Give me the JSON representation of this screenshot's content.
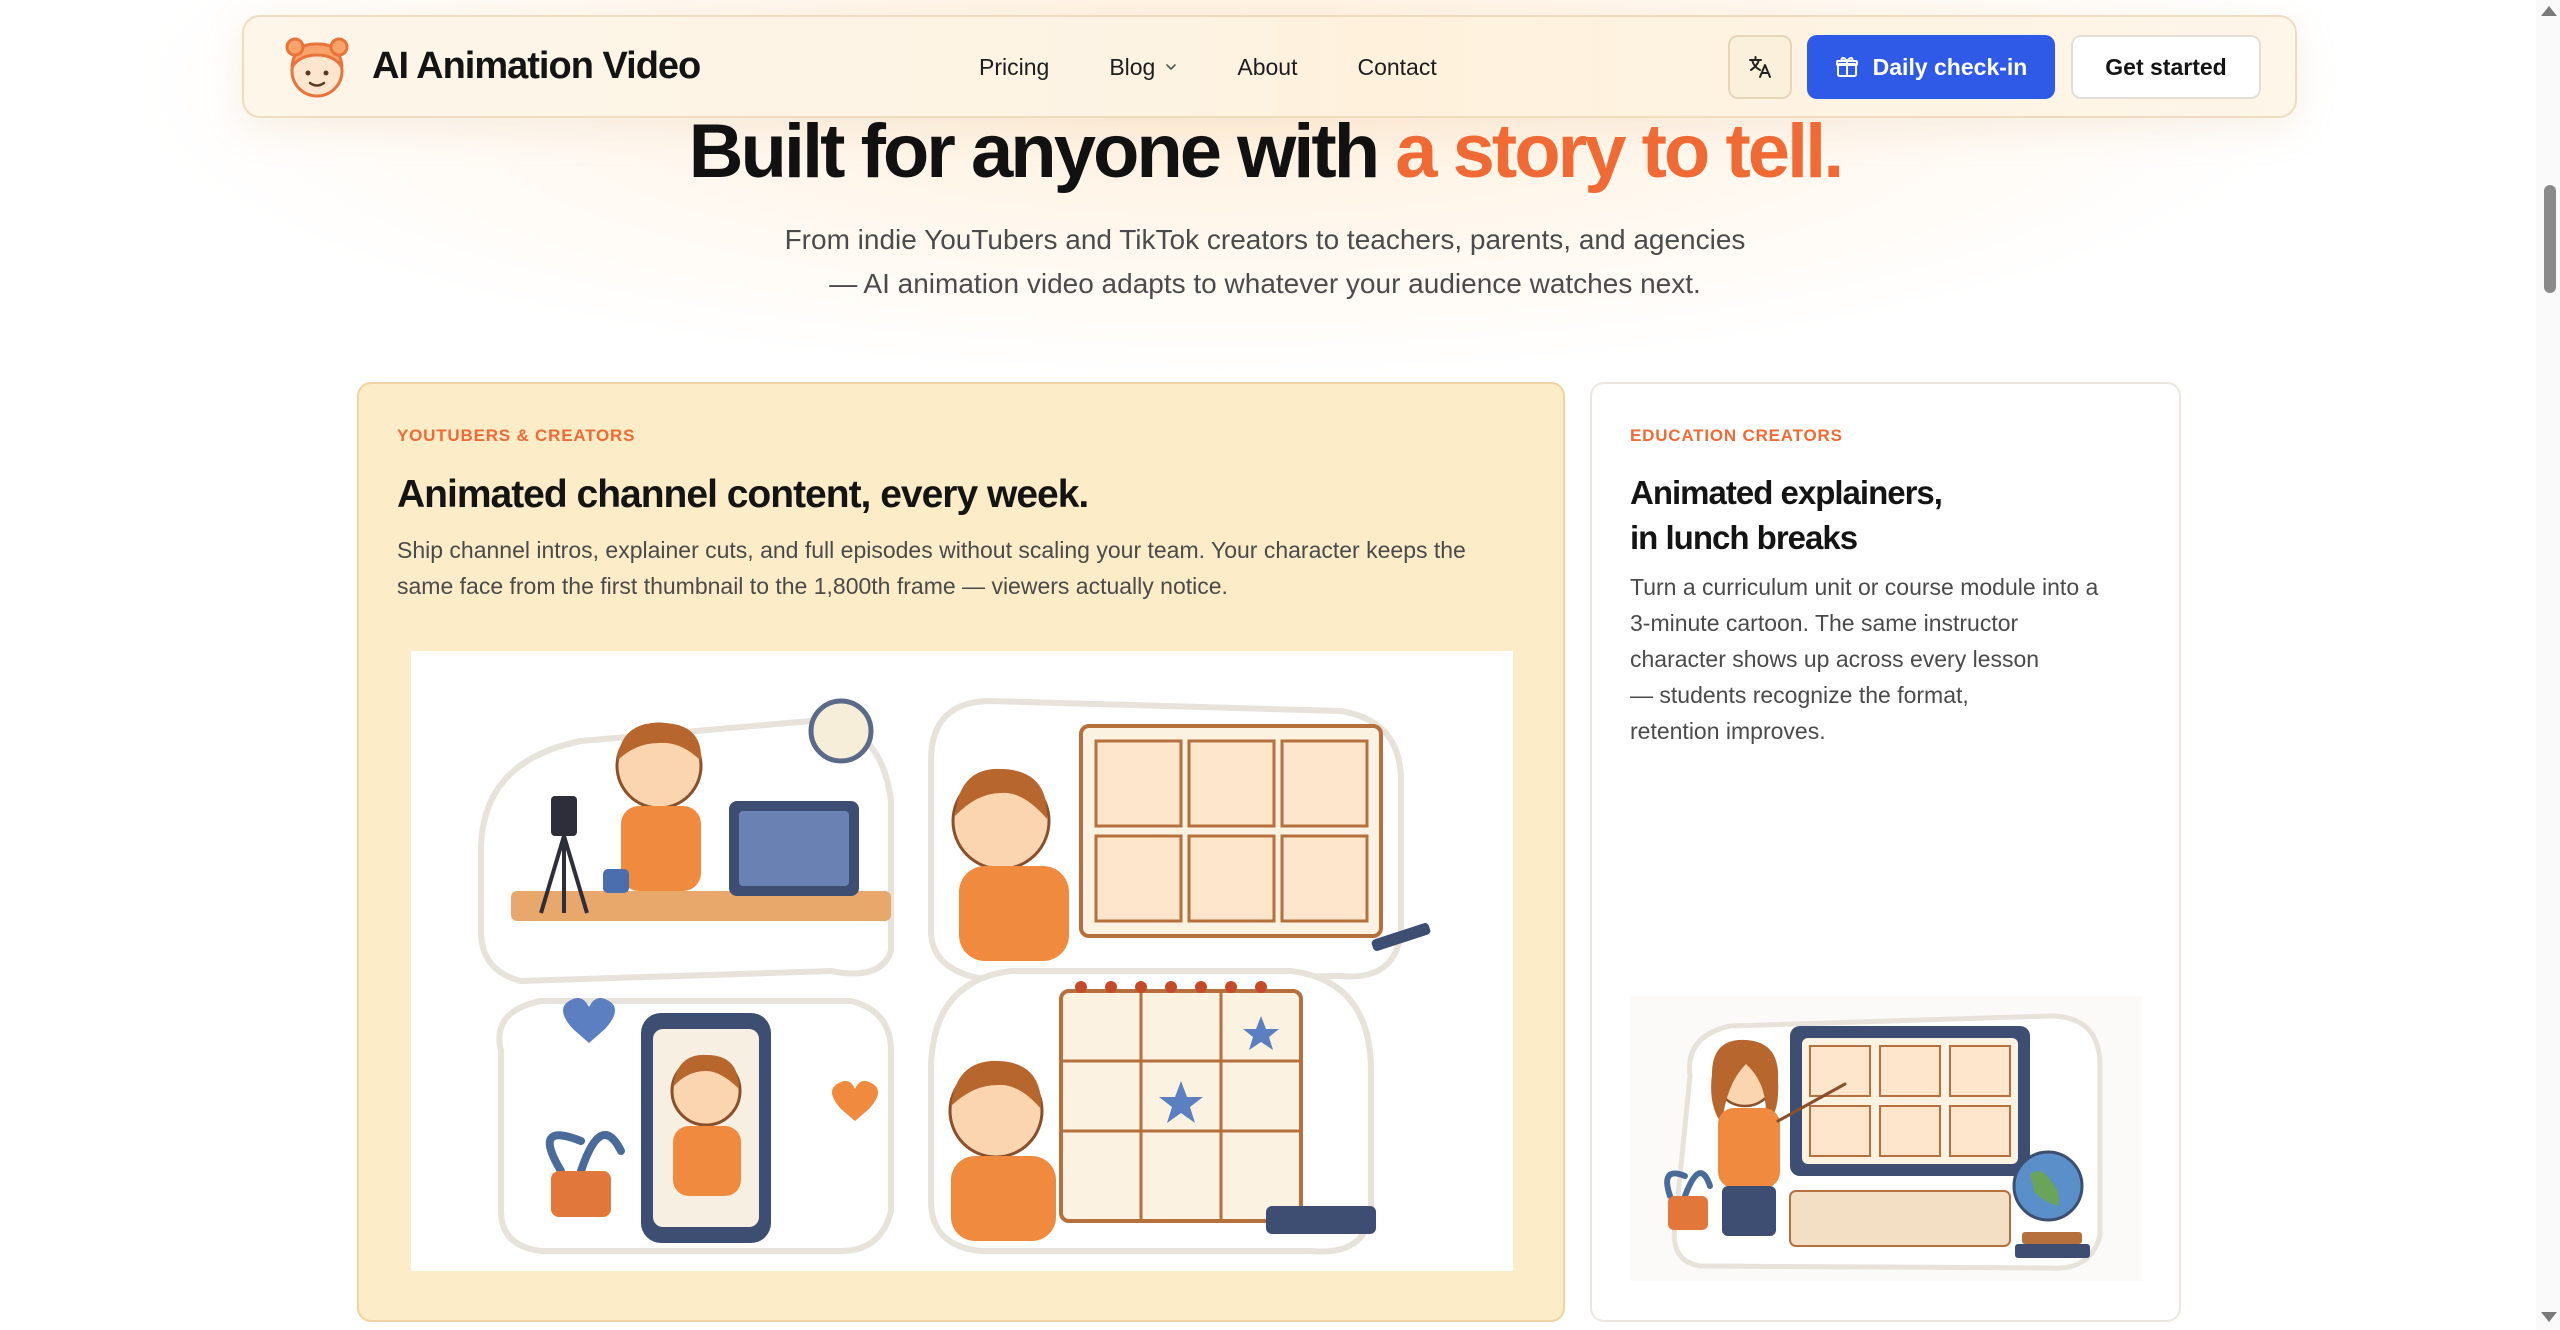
{
  "header": {
    "brand": "AI Animation Video",
    "nav": [
      {
        "label": "Pricing"
      },
      {
        "label": "Blog"
      },
      {
        "label": "About"
      },
      {
        "label": "Contact"
      }
    ],
    "checkin_label": "Daily check-in",
    "started_label": "Get started"
  },
  "hero": {
    "title_main": "Built for anyone with ",
    "title_accent": "a story to tell.",
    "subtitle_line1": "From indie YouTubers and TikTok creators to teachers, parents, and agencies",
    "subtitle_line2": "— AI animation video adapts to whatever your audience watches next."
  },
  "cards": [
    {
      "tag": "YOUTUBERS & CREATORS",
      "title": "Animated channel content, every week.",
      "desc_line1": "Ship channel intros, explainer cuts, and full episodes without scaling your team. Your character keeps the",
      "desc_line2": "same face from the first thumbnail to the 1,800th frame — viewers actually notice."
    },
    {
      "tag": "EDUCATION CREATORS",
      "title_line1": "Animated explainers,",
      "title_line2": "in lunch breaks",
      "desc_lines": [
        "Turn a curriculum unit or course module into a",
        "3-minute cartoon. The same instructor",
        "character shows up across every lesson",
        "— students recognize the format,",
        "retention improves."
      ]
    }
  ],
  "colors": {
    "accent": "#f06a35",
    "primary_button": "#2f5ae8",
    "card_highlight": "#fdecc8"
  }
}
